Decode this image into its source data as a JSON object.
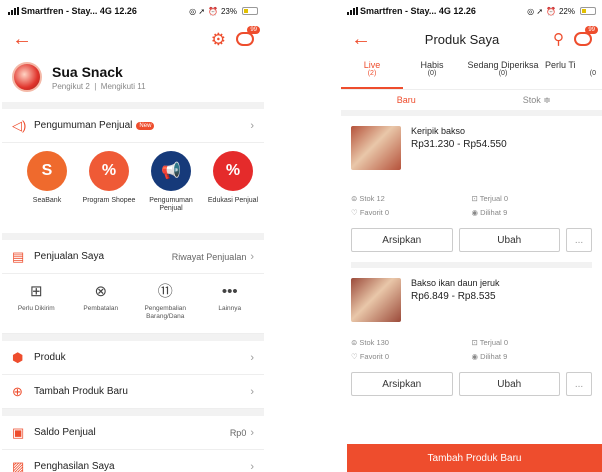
{
  "status_left": {
    "carrier": "Smartfren - Stay...",
    "network": "4G",
    "time": "12.26",
    "battery": "23%"
  },
  "status_right": {
    "carrier": "Smartfren - Stay...",
    "network": "4G",
    "time": "12.26",
    "battery": "22%"
  },
  "screen1": {
    "chat_badge": "99",
    "shop": {
      "name": "Sua Snack",
      "followers": "Pengikut 2",
      "following": "Mengikuti 11"
    },
    "announcement": {
      "label": "Pengumuman Penjual",
      "tag": "New"
    },
    "circles": [
      {
        "label": "SeaBank",
        "icon": "seabank-icon",
        "color": "#ef6a2d",
        "glyph": "S"
      },
      {
        "label": "Program Shopee",
        "icon": "discount-tag-icon",
        "color": "#ef5a36",
        "glyph": "%"
      },
      {
        "label": "Pengumuman Penjual",
        "icon": "megaphone-icon",
        "color": "#163a7a",
        "glyph": "📢"
      },
      {
        "label": "Edukasi Penjual",
        "icon": "education-icon",
        "color": "#e52b2b",
        "glyph": "%"
      }
    ],
    "sales": {
      "label": "Penjualan Saya",
      "link": "Riwayat Penjualan"
    },
    "quick": [
      {
        "label": "Perlu Dikirim",
        "icon": "package-icon",
        "glyph": "⊞"
      },
      {
        "label": "Pembatalan",
        "icon": "cancel-icon",
        "glyph": "⊗"
      },
      {
        "label": "Pengembalian Barang/Dana",
        "icon": "return-icon",
        "glyph": "⑪"
      },
      {
        "label": "Lainnya",
        "icon": "more-icon",
        "glyph": "•••"
      }
    ],
    "produk": "Produk",
    "tambah": "Tambah Produk Baru",
    "saldo": {
      "label": "Saldo Penjual",
      "value": "Rp0"
    },
    "penghasilan": "Penghasilan Saya"
  },
  "screen2": {
    "title": "Produk Saya",
    "chat_badge": "99",
    "tabs": [
      {
        "label": "Live",
        "count": "(2)"
      },
      {
        "label": "Habis",
        "count": "(0)"
      },
      {
        "label": "Sedang Diperiksa",
        "count": "(0)"
      },
      {
        "label": "Perlu Ti",
        "count": "(0"
      }
    ],
    "sort": {
      "baru": "Baru",
      "stok": "Stok ≑"
    },
    "products": [
      {
        "name": "Keripik bakso",
        "price": "Rp31.230 - Rp54.550",
        "stok": "Stok 12",
        "terjual": "Terjual 0",
        "favorit": "Favorit 0",
        "dilihat": "Dilihat 9",
        "color": "#b5523b"
      },
      {
        "name": "Bakso ikan daun jeruk",
        "price": "Rp6.849 - Rp8.535",
        "stok": "Stok 130",
        "terjual": "Terjual 0",
        "favorit": "Favorit 0",
        "dilihat": "Dilihat 9",
        "color": "#9b4a3a"
      }
    ],
    "btn_arsip": "Arsipkan",
    "btn_ubah": "Ubah",
    "btn_more": "...",
    "cta": "Tambah Produk Baru"
  }
}
